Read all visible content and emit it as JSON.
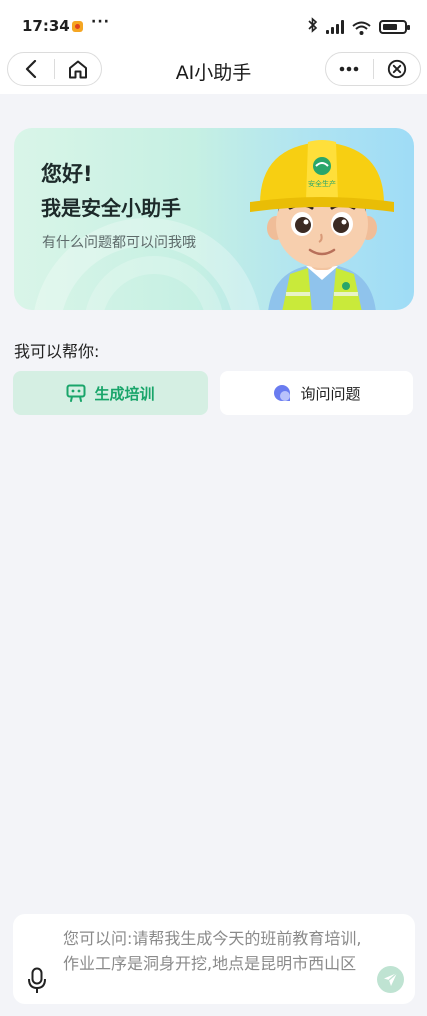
{
  "status_bar": {
    "time": "17:34",
    "more": "···"
  },
  "nav": {
    "title": "AI小助手",
    "icons": [
      "back-icon",
      "home-icon",
      "more-icon",
      "close-icon"
    ]
  },
  "hero": {
    "greeting": "您好!",
    "intro": "我是安全小助手",
    "subtitle": "有什么问题都可以问我哦",
    "helmet_text": "安全生产"
  },
  "help": {
    "label": "我可以帮你:",
    "actions": [
      {
        "label": "生成培训",
        "icon": "training-icon",
        "selected": true
      },
      {
        "label": "询问问题",
        "icon": "chat-bubble-icon",
        "selected": false
      }
    ]
  },
  "input": {
    "placeholder": "您可以问:请帮我生成今天的班前教育培训,作业工序是洞身开挖,地点是昆明市西山区"
  },
  "colors": {
    "accent": "#19a56a",
    "accent_light": "#d5efe3",
    "page_bg": "#f3f4f8",
    "ask_icon": "#6a7cf0"
  }
}
